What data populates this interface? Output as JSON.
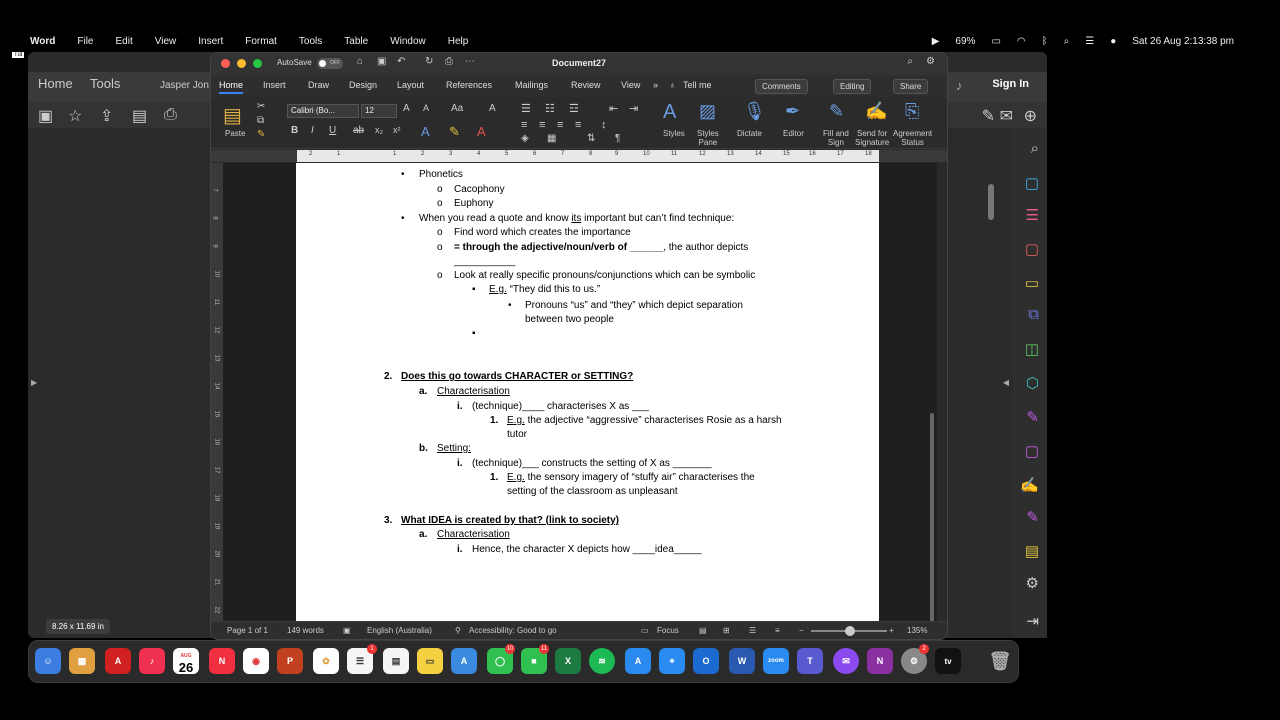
{
  "menubar": {
    "apple": "",
    "app": "Word",
    "items": [
      "File",
      "Edit",
      "View",
      "Insert",
      "Format",
      "Tools",
      "Table",
      "Window",
      "Help"
    ],
    "battery": "69%",
    "datetime": "Sat 26 Aug  2:13:38 pm"
  },
  "tut_label": "Tut",
  "acrobat": {
    "tabs": [
      "Home",
      "Tools",
      "Jasper Jon"
    ],
    "sign_in": "Sign In",
    "page_size": "8.26 x 11.69 in"
  },
  "word": {
    "autosave": "AutoSave",
    "autosave_state": "OFF",
    "title": "Document27",
    "tabs": [
      "Home",
      "Insert",
      "Draw",
      "Design",
      "Layout",
      "References",
      "Mailings",
      "Review",
      "View"
    ],
    "tell_me": "Tell me",
    "comments": "Comments",
    "editing": "Editing",
    "share": "Share",
    "ribbon": {
      "paste": "Paste",
      "font": "Calibri (Bo...",
      "size": "12",
      "styles": "Styles",
      "styles_pane": [
        "Styles",
        "Pane"
      ],
      "dictate": "Dictate",
      "editor": "Editor",
      "fill_sign": [
        "Fill and",
        "Sign"
      ],
      "send_signature": [
        "Send for",
        "Signature"
      ],
      "agreement": [
        "Agreement",
        "Status"
      ]
    },
    "ruler_numbers": [
      "2",
      "1",
      "1",
      "2",
      "3",
      "4",
      "5",
      "6",
      "7",
      "8",
      "9",
      "10",
      "11",
      "12",
      "13",
      "14",
      "15",
      "16",
      "17",
      "18"
    ],
    "vruler_numbers": [
      "7",
      "8",
      "9",
      "10",
      "11",
      "12",
      "13",
      "14",
      "15",
      "16",
      "17",
      "18",
      "19",
      "20",
      "21",
      "22"
    ],
    "status": {
      "page": "Page 1 of 1",
      "words": "149 words",
      "lang": "English (Australia)",
      "accessibility": "Accessibility: Good to go",
      "focus": "Focus",
      "zoom": "135%"
    }
  },
  "document": {
    "l1": "Phonetics",
    "l2": "Cacophony",
    "l3": "Euphony",
    "l4a": "When you read a quote and know ",
    "l4b": "its",
    "l4c": " important but can’t find technique:",
    "l5": "Find word which creates the importance",
    "l6a": "= through the adjective/noun/verb of ______",
    "l6b": ", the author depicts",
    "l7": "___________",
    "l8": "Look at really specific pronouns/conjunctions which can be symbolic",
    "l9a": "E.g.",
    "l9b": " “They did this to us.”",
    "l10": "Pronouns “us” and “they” which depict separation",
    "l11": "between two people",
    "h2num": "2.",
    "h2": "Does this go towards CHARACTER or SETTING?",
    "a_label": "a.",
    "a_text": "Characterisation",
    "ai_label": "i.",
    "ai_text": "(technique)____ characterises X as ___",
    "ai1_label": "1.",
    "ai1_eg": "E.g.",
    "ai1_text": " the adjective “aggressive” characterises Rosie as a harsh",
    "ai1_text2": "tutor",
    "b_label": "b.",
    "b_text": "Setting:",
    "bi_label": "i.",
    "bi_text": "(technique)___ constructs the setting of X as _______",
    "bi1_label": "1.",
    "bi1_eg": "E.g.",
    "bi1_text": " the sensory imagery of “stuffy air” characterises the",
    "bi1_text2": "setting of the classroom as unpleasant",
    "h3num": "3.",
    "h3a": "What IDEA is created by that? (",
    "h3b": "link",
    "h3c": " to society)",
    "c_label": "a.",
    "c_text": "Characterisation",
    "ci_label": "i.",
    "ci_text": "Hence, the character X depicts how ____idea_____"
  },
  "dock": {
    "calendar_month": "AUG",
    "calendar_day": "26",
    "badges": [
      "1",
      "10",
      "11",
      "2"
    ],
    "zoom": "zoom",
    "tv": "tv"
  }
}
